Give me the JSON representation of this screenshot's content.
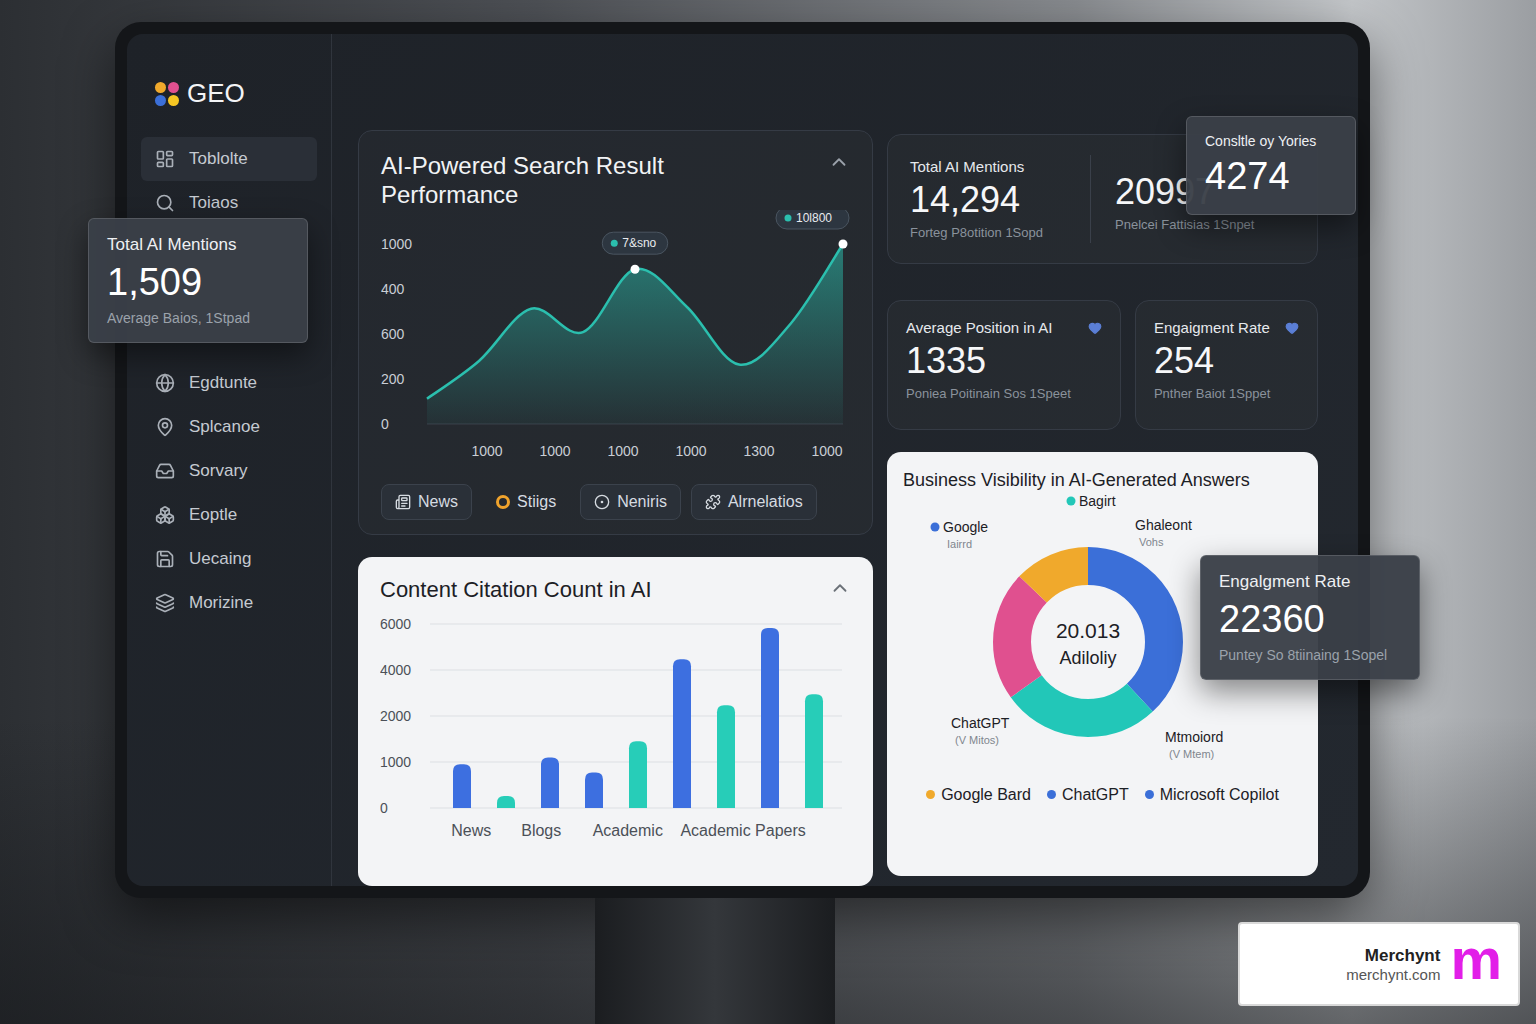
{
  "sidebar": {
    "logo": "GEO",
    "items": [
      {
        "label": "Toblolte",
        "selected": true
      },
      {
        "label": "Toiaos",
        "selected": false
      },
      {
        "label": "Egdtunte",
        "selected": false
      },
      {
        "label": "Splcanoe",
        "selected": false
      },
      {
        "label": "Sorvary",
        "selected": false
      },
      {
        "label": "Eoptle",
        "selected": false
      },
      {
        "label": "Uecaing",
        "selected": false
      },
      {
        "label": "Morizine",
        "selected": false
      }
    ]
  },
  "search_chart": {
    "title": "AI-Powered Search Result Performance",
    "y_ticks": [
      "1000",
      "400",
      "600",
      "200",
      "0"
    ],
    "x_ticks": [
      "1000",
      "1000",
      "1000",
      "1000",
      "1300",
      "1000"
    ],
    "series": [
      {
        "values": [
          140,
          350,
          640,
          510,
          860,
          650,
          330,
          560,
          1000
        ],
        "color": "#2bbfae"
      }
    ],
    "markers": [
      {
        "label": "7&sno",
        "index": 4
      },
      {
        "label": "10l800",
        "index": 8
      }
    ],
    "filters": [
      {
        "label": "News",
        "kind": "chip"
      },
      {
        "label": "Stiigs",
        "kind": "plain"
      },
      {
        "label": "Neniris",
        "kind": "chip"
      },
      {
        "label": "Alrnelatios",
        "kind": "chip"
      }
    ]
  },
  "stats": {
    "total_mentions": {
      "label": "Total AI Mentions",
      "value": "14,294",
      "caption": "Forteg P8otition 1Sopd",
      "second_value": "20997",
      "second_caption": "Pnelcei Fattisias 1Snpet"
    },
    "cards": [
      {
        "label": "Average Position in AI",
        "value": "1335",
        "caption": "Poniea Poitinain Sos 1Speet"
      },
      {
        "label": "Engaigment Rate",
        "value": "254",
        "caption": "Pnther Baiot 1Sppet"
      }
    ]
  },
  "citation_chart": {
    "title": "Content Citation Count in AI",
    "y_ticks": [
      "6000",
      "4000",
      "2000",
      "1000",
      "0"
    ],
    "x_labels": [
      "News",
      "Blogs",
      "Academic",
      "Academic Papers"
    ],
    "bars": [
      {
        "value": 950,
        "color": "#3d6fe0"
      },
      {
        "value": 260,
        "color": "#27cdb8"
      },
      {
        "value": 1100,
        "color": "#3d6fe0"
      },
      {
        "value": 770,
        "color": "#3d6fe0"
      },
      {
        "value": 1450,
        "color": "#27cdb8"
      },
      {
        "value": 4470,
        "color": "#3d6fe0"
      },
      {
        "value": 2470,
        "color": "#27cdb8"
      },
      {
        "value": 5830,
        "color": "#3d6fe0"
      },
      {
        "value": 2950,
        "color": "#27cdb8"
      }
    ]
  },
  "visibility_chart": {
    "title": "Business Visibility in AI-Generated Answers",
    "center_value": "20.013",
    "center_label": "Adiloliy",
    "segments": [
      {
        "value": 38,
        "color": "#3b6fd8"
      },
      {
        "value": 27,
        "color": "#22c7b8"
      },
      {
        "value": 22,
        "color": "#e0508f"
      },
      {
        "value": 13,
        "color": "#f0a92c"
      }
    ],
    "callouts": [
      {
        "text": "Bagirt",
        "color": "#22c7b8"
      },
      {
        "text": "Google",
        "sub": "Iairrd",
        "color": "#3b6fd8"
      },
      {
        "text": "Ghaleont",
        "sub": "Vohs"
      },
      {
        "text": "ChatGPT",
        "sub": "(V Mitos)"
      },
      {
        "text": "Mtmoiord",
        "sub": "(V Mtem)"
      }
    ],
    "legend": [
      {
        "label": "Google Bard",
        "color": "#f0a92c"
      },
      {
        "label": "ChatGPT",
        "color": "#3b6fd8"
      },
      {
        "label": "Microsoft Copilot",
        "color": "#3b6fd8"
      }
    ]
  },
  "floating_cards": [
    {
      "label": "Total AI Mentions",
      "value": "1,509",
      "caption": "Average Baios, 1Stpad"
    },
    {
      "label": "Consltle oy Yories",
      "value": "4274"
    },
    {
      "label": "Engalgment Rate",
      "value": "22360",
      "caption": "Puntey So 8tiinaing 1Sopel"
    }
  ],
  "brand": {
    "name": "Merchynt",
    "url": "merchynt.com",
    "mark": "m"
  }
}
